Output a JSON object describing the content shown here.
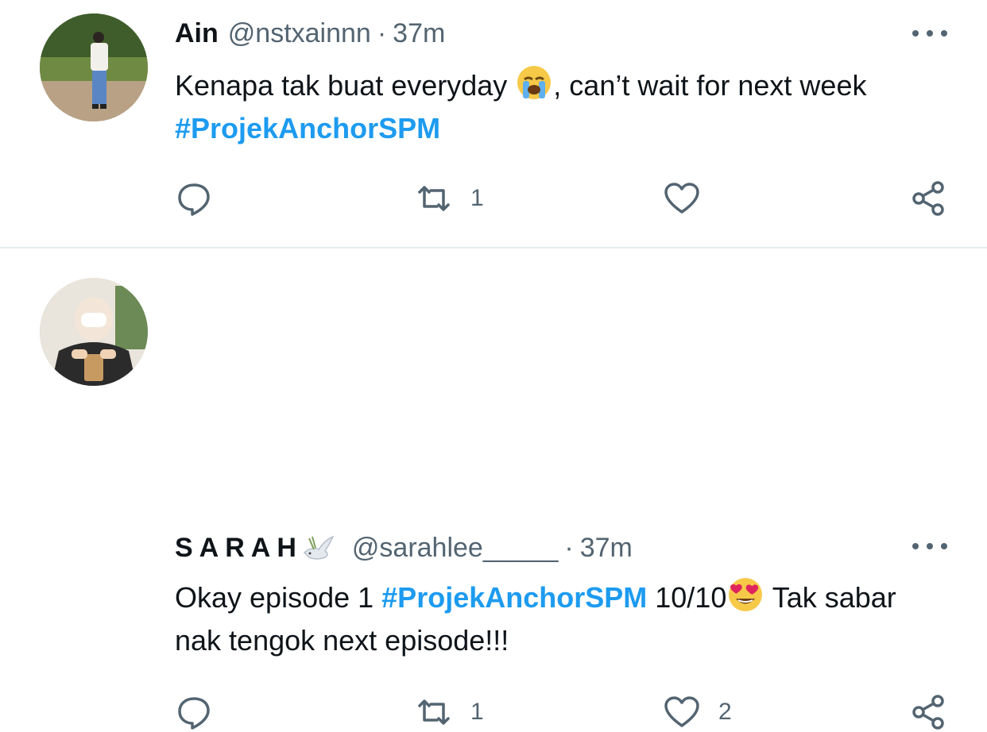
{
  "colors": {
    "hashtag": "#1d9bf0",
    "secondary": "#536471",
    "text": "#0f1419",
    "divider": "#e6ecf0"
  },
  "tweets": [
    {
      "name": "Ain",
      "handle": "@nstxainnn",
      "dot": "·",
      "time": "37m",
      "text_before": "Kenapa tak buat everyday ",
      "emoji1": "loudly-crying-face",
      "text_middle": ", can’t wait for next week ",
      "hashtag": "#ProjekAnchorSPM",
      "text_after": "",
      "emoji2": "",
      "text_end": "",
      "replies": "",
      "retweets": "1",
      "likes": "",
      "icons": [
        "reply-icon",
        "retweet-icon",
        "heart-icon",
        "share-icon",
        "more-icon"
      ]
    },
    {
      "name": "SARAH",
      "name_emoji": "dove",
      "handle": "@sarahlee_____",
      "dot": "·",
      "time": "37m",
      "text_before": "Okay episode 1 ",
      "hashtag": "#ProjekAnchorSPM",
      "text_after": " 10/10",
      "emoji2": "smiling-face-with-heart-eyes",
      "text_end": " Tak sabar nak tengok next episode!!!",
      "replies": "",
      "retweets": "1",
      "likes": "2",
      "icons": [
        "reply-icon",
        "retweet-icon",
        "heart-icon",
        "share-icon",
        "more-icon"
      ]
    }
  ]
}
